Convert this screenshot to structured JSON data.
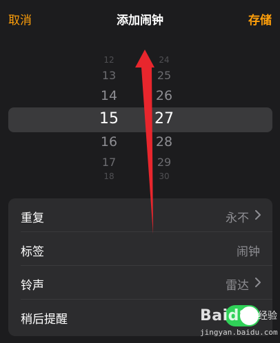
{
  "navbar": {
    "cancel_label": "取消",
    "title": "添加闹钟",
    "save_label": "存储"
  },
  "picker": {
    "hours": [
      "12",
      "13",
      "14",
      "15",
      "16",
      "17",
      "18"
    ],
    "minutes": [
      "24",
      "25",
      "26",
      "27",
      "28",
      "29",
      "30"
    ],
    "selected_hour": "15",
    "selected_minute": "27"
  },
  "settings": {
    "repeat": {
      "label": "重复",
      "value": "永不"
    },
    "label": {
      "label": "标签",
      "placeholder": "闹钟"
    },
    "sound": {
      "label": "铃声",
      "value": "雷达"
    },
    "snooze": {
      "label": "稍后提醒",
      "on": true
    }
  },
  "watermark": {
    "logo": "Baidu",
    "cn": "经验",
    "url": "jingyan.baidu.com"
  },
  "colors": {
    "accent": "#ff9f0a",
    "toggle_on": "#30d158",
    "annotation_arrow": "#e8262d"
  },
  "icons": [
    "chevron-right-icon",
    "annotation-arrow",
    "baidu-paw-icon"
  ]
}
